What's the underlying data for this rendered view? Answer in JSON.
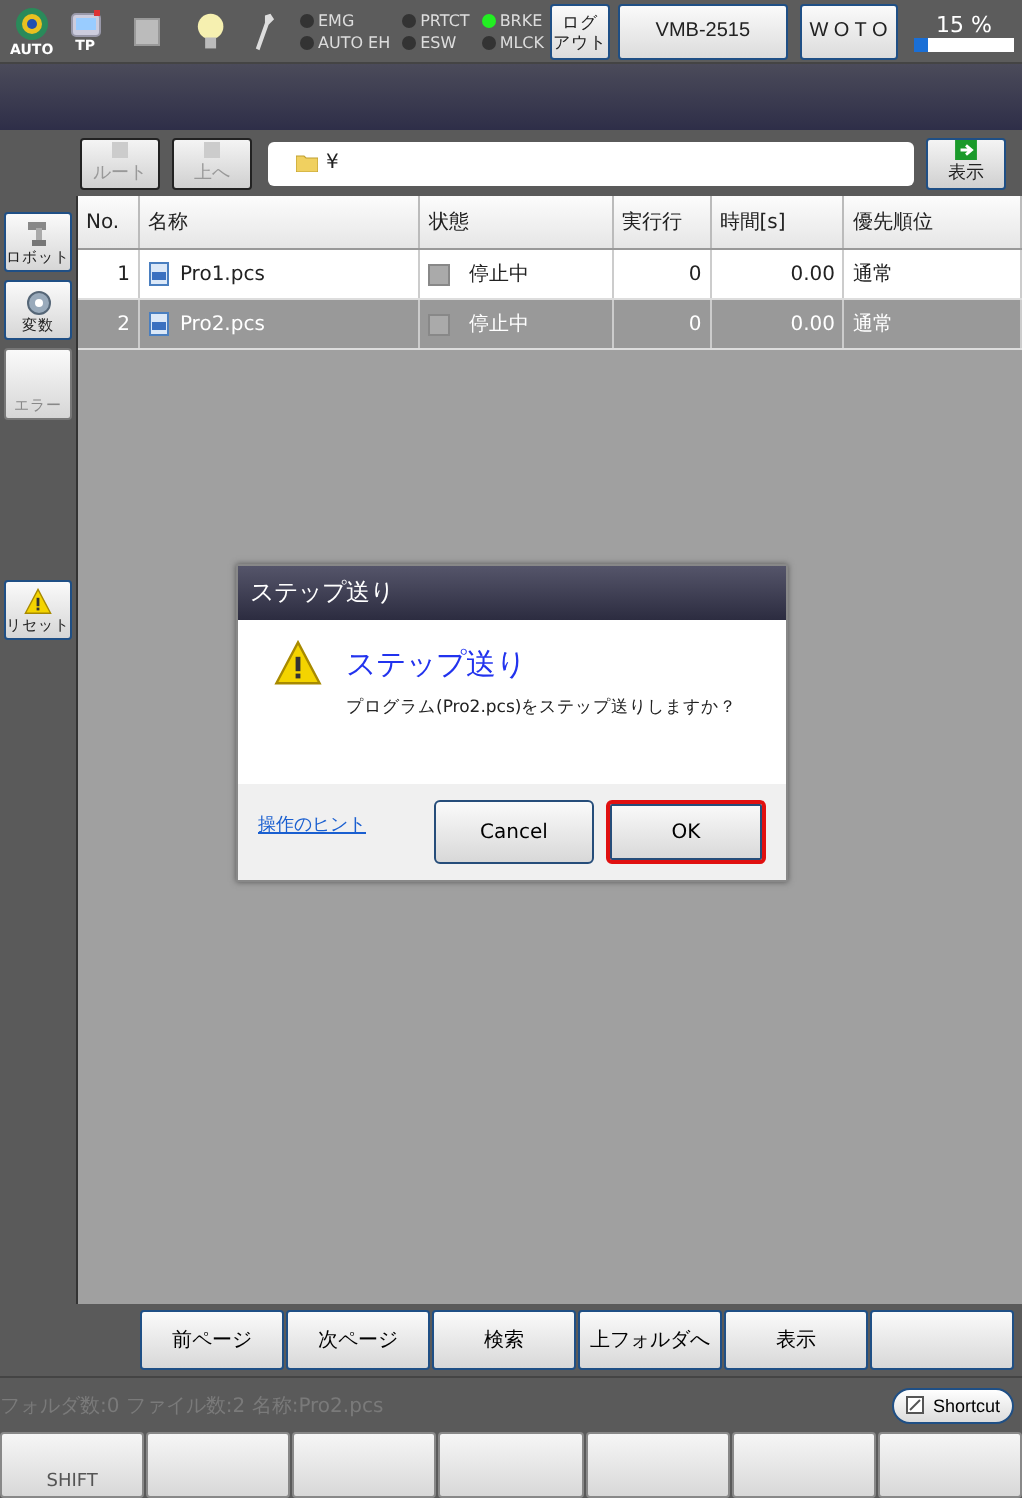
{
  "status_bar_top": {
    "mode_label": "AUTO",
    "pendant_label": "TP",
    "indicators": [
      {
        "label": "EMG",
        "on": false
      },
      {
        "label": "PRTCT",
        "on": false
      },
      {
        "label": "BRKE",
        "on": true
      },
      {
        "label": "AUTO EH",
        "on": false
      },
      {
        "label": "ESW",
        "on": false
      },
      {
        "label": "MLCK",
        "on": false
      }
    ],
    "logout_button": [
      "ログ",
      "アウト"
    ],
    "robot_button": "VMB-2515",
    "coord_button": "W O T O",
    "speed": "15 %",
    "speed_level": {
      "level": 0.15
    }
  },
  "toolbar": {
    "buttons": [
      {
        "label": "ルート",
        "disabled": true
      },
      {
        "label": "上へ",
        "disabled": true
      }
    ],
    "path": "¥",
    "show_button": "表示"
  },
  "sidebar": [
    {
      "kind": "robot",
      "label": "ロボット",
      "disabled": false
    },
    {
      "kind": "variable",
      "label": "変数",
      "disabled": false
    },
    {
      "kind": "error",
      "label": "エラー",
      "disabled": true
    },
    {
      "kind": "reset",
      "label": "リセット",
      "disabled": false
    }
  ],
  "table": {
    "columns": [
      "No.",
      "名称",
      "状態",
      "実行行",
      "時間[s]",
      "優先順位"
    ],
    "rows": [
      {
        "no": "1",
        "name": "Pro1.pcs",
        "state": "停止中",
        "line": "0",
        "time": "0.00",
        "priority": "通常",
        "selected": false
      },
      {
        "no": "2",
        "name": "Pro2.pcs",
        "state": "停止中",
        "line": "0",
        "time": "0.00",
        "priority": "通常",
        "selected": true
      }
    ]
  },
  "dialog": {
    "title": "ステップ送り",
    "heading": "ステップ送り",
    "message": "プログラム(Pro2.pcs)をステップ送りしますか？",
    "hint_link": "操作のヒント",
    "buttons": [
      {
        "label": "Cancel",
        "focused": false
      },
      {
        "label": "OK",
        "focused": true
      }
    ]
  },
  "page_buttons": [
    {
      "kind": "labeled",
      "label": "前ページ"
    },
    {
      "kind": "labeled",
      "label": "次ページ"
    },
    {
      "kind": "labeled",
      "label": "検索"
    },
    {
      "kind": "labeled",
      "label": "上フォルダへ"
    },
    {
      "kind": "labeled",
      "label": "表示"
    },
    {
      "kind": "blank"
    }
  ],
  "status_text": "フォルダ数:0  ファイル数:2  名称:Pro2.pcs",
  "shortcut_button": "Shortcut",
  "function_keys": [
    {
      "kind": "labeled",
      "label": "SHIFT"
    },
    {
      "kind": "blank"
    },
    {
      "kind": "blank"
    },
    {
      "kind": "blank"
    },
    {
      "kind": "blank"
    },
    {
      "kind": "blank"
    },
    {
      "kind": "blank"
    }
  ]
}
